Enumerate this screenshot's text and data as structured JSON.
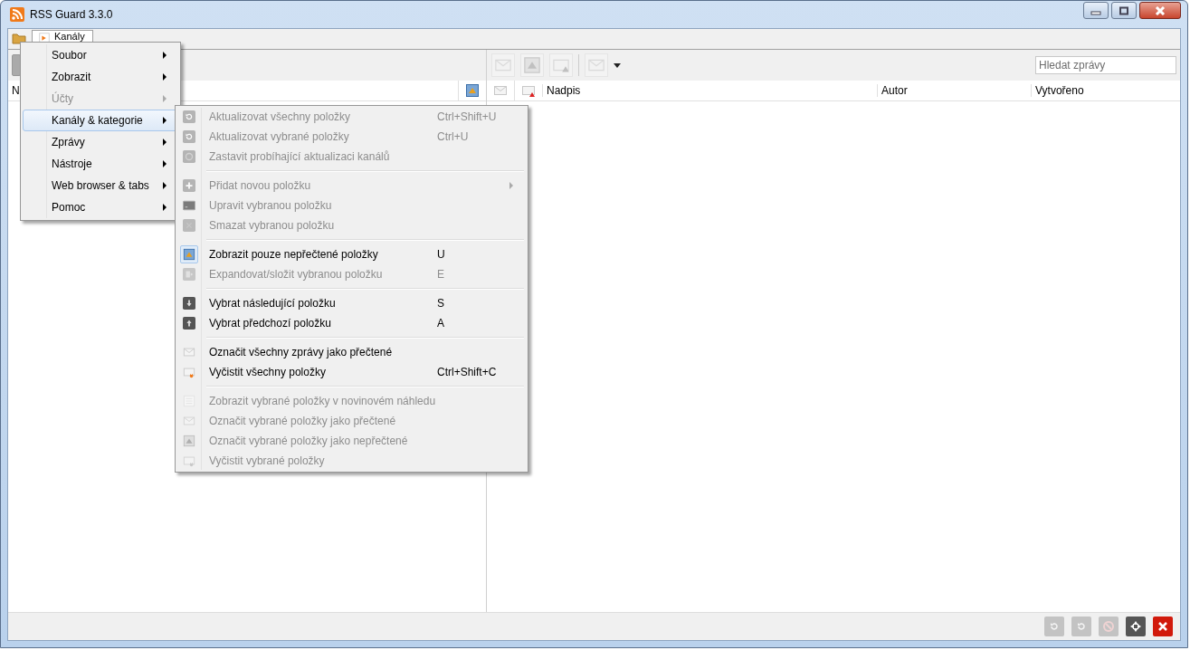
{
  "window": {
    "title": "RSS Guard 3.3.0"
  },
  "tabs": [
    {
      "label": "Kanály",
      "selected": true
    }
  ],
  "feeds_pane": {
    "header": "N"
  },
  "messages_toolbar": {
    "buttons": [
      {
        "disabled": true
      },
      {
        "disabled": true
      },
      {
        "disabled": true
      },
      {
        "disabled": true
      }
    ],
    "search": {
      "placeholder": "Hledat zprávy"
    }
  },
  "messages_table": {
    "columns": [
      "Nadpis",
      "Autor",
      "Vytvořeno"
    ]
  },
  "status_bar": {
    "buttons": [
      {
        "disabled": true
      },
      {
        "disabled": true
      },
      {
        "disabled": true
      },
      {
        "disabled": false
      },
      {
        "disabled": false
      }
    ]
  },
  "main_menu": {
    "items": [
      {
        "label": "Soubor",
        "disabled": false,
        "selected": false
      },
      {
        "label": "Zobrazit",
        "disabled": false,
        "selected": false
      },
      {
        "label": "Účty",
        "disabled": true,
        "selected": false
      },
      {
        "label": "Kanály & kategorie",
        "disabled": false,
        "selected": true
      },
      {
        "label": "Zprávy",
        "disabled": false,
        "selected": false
      },
      {
        "label": "Nástroje",
        "disabled": false,
        "selected": false
      },
      {
        "label": "Web browser & tabs",
        "disabled": false,
        "selected": false
      },
      {
        "label": "Pomoc",
        "disabled": false,
        "selected": false
      }
    ]
  },
  "submenu": {
    "groups": [
      [
        {
          "label": "Aktualizovat všechny položky",
          "shortcut": "Ctrl+Shift+U",
          "disabled": true,
          "checked": false,
          "has_submenu": false
        },
        {
          "label": "Aktualizovat vybrané položky",
          "shortcut": "Ctrl+U",
          "disabled": true,
          "checked": false,
          "has_submenu": false
        },
        {
          "label": "Zastavit probíhající aktualizaci kanálů",
          "disabled": true,
          "checked": false,
          "has_submenu": false
        }
      ],
      [
        {
          "label": "Přidat novou položku",
          "disabled": true,
          "checked": false,
          "has_submenu": true
        },
        {
          "label": "Upravit vybranou položku",
          "disabled": true,
          "checked": false,
          "has_submenu": false
        },
        {
          "label": "Smazat vybranou položku",
          "disabled": true,
          "checked": false,
          "has_submenu": false
        }
      ],
      [
        {
          "label": "Zobrazit pouze nepřečtené položky",
          "shortcut": "U",
          "disabled": false,
          "checked": true,
          "has_submenu": false
        },
        {
          "label": "Expandovat/složit vybranou položku",
          "shortcut": "E",
          "disabled": true,
          "checked": false,
          "has_submenu": false
        }
      ],
      [
        {
          "label": "Vybrat následující položku",
          "shortcut": "S",
          "disabled": false,
          "checked": false,
          "has_submenu": false
        },
        {
          "label": "Vybrat předchozí položku",
          "shortcut": "A",
          "disabled": false,
          "checked": false,
          "has_submenu": false
        }
      ],
      [
        {
          "label": "Označit všechny zprávy jako přečtené",
          "disabled": false,
          "checked": false,
          "has_submenu": false
        },
        {
          "label": "Vyčistit všechny položky",
          "shortcut": "Ctrl+Shift+C",
          "disabled": false,
          "checked": false,
          "has_submenu": false
        }
      ],
      [
        {
          "label": "Zobrazit vybrané položky v novinovém náhledu",
          "disabled": true,
          "checked": false,
          "has_submenu": false
        },
        {
          "label": "Označit vybrané položky jako přečtené",
          "disabled": true,
          "checked": false,
          "has_submenu": false
        },
        {
          "label": "Označit vybrané položky jako nepřečtené",
          "disabled": true,
          "checked": false,
          "has_submenu": false
        },
        {
          "label": "Vyčistit vybrané položky",
          "disabled": true,
          "checked": false,
          "has_submenu": false
        }
      ]
    ]
  }
}
